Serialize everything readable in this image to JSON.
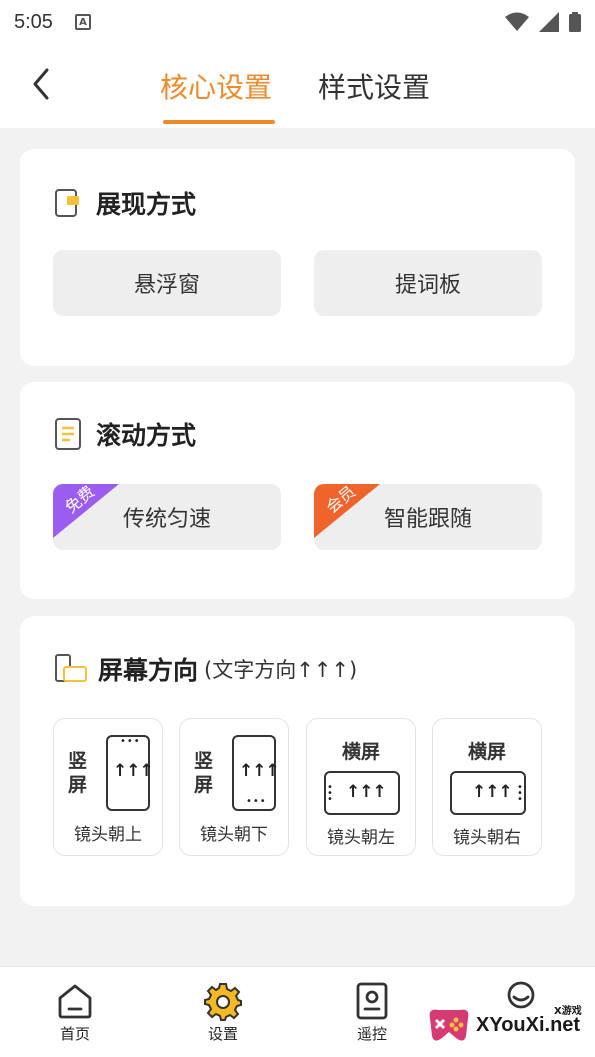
{
  "status_bar": {
    "time": "5:05",
    "notification_icon": "A"
  },
  "header": {
    "tabs": [
      {
        "label": "核心设置",
        "active": true
      },
      {
        "label": "样式设置",
        "active": false
      }
    ]
  },
  "display_mode": {
    "title": "展现方式",
    "options": [
      "悬浮窗",
      "提词板"
    ]
  },
  "scroll_mode": {
    "title": "滚动方式",
    "options": [
      {
        "label": "传统匀速",
        "badge": "免费",
        "badge_color": "#9b5cf0"
      },
      {
        "label": "智能跟随",
        "badge": "会员",
        "badge_color": "#f0632b"
      }
    ]
  },
  "screen_orientation": {
    "title": "屏幕方向",
    "subtitle": "(文字方向↑↑↑)",
    "options": [
      {
        "type_label": "竖屏",
        "caption": "镜头朝上",
        "arrows": "↑↑↑"
      },
      {
        "type_label": "竖屏",
        "caption": "镜头朝下",
        "arrows": "↑↑↑"
      },
      {
        "type_label": "横屏",
        "caption": "镜头朝左",
        "arrows": "↑↑↑"
      },
      {
        "type_label": "横屏",
        "caption": "镜头朝右",
        "arrows": "↑↑↑"
      }
    ]
  },
  "bottom_nav": [
    {
      "label": "首页",
      "icon": "home-icon"
    },
    {
      "label": "设置",
      "icon": "gear-icon",
      "active": true
    },
    {
      "label": "遥控",
      "icon": "remote-icon"
    },
    {
      "label": "",
      "icon": "profile-icon"
    }
  ],
  "watermark": {
    "text": "XYouXi.net",
    "small": "X游戏"
  },
  "colors": {
    "accent": "#f0892b",
    "free_badge": "#9b5cf0",
    "vip_badge": "#f0632b",
    "gear": "#f5b921"
  }
}
